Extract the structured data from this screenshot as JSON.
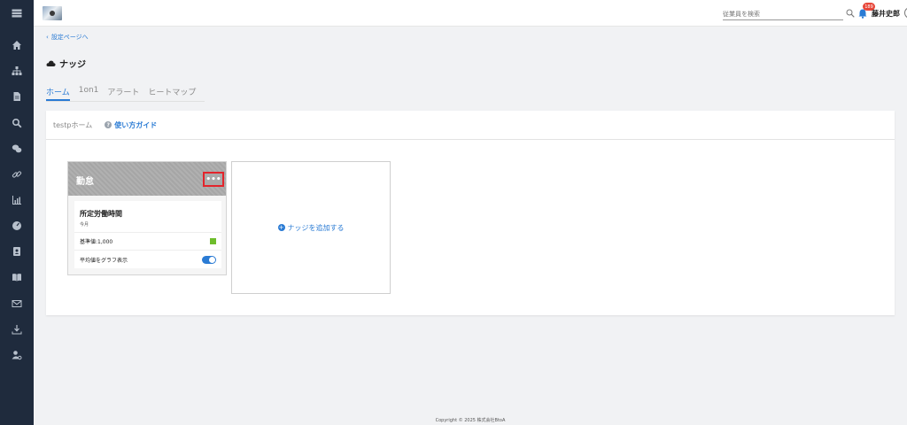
{
  "header": {
    "search_placeholder": "従業員を検索",
    "notification_count": "189",
    "user_name": "藤井史郎"
  },
  "sidebar": {
    "icons": [
      "menu-icon",
      "home-icon",
      "org-chart-icon",
      "document-icon",
      "search-icon",
      "chat-icon",
      "link-icon",
      "chart-icon",
      "gauge-icon",
      "contact-book-icon",
      "book-icon",
      "mail-icon",
      "download-icon",
      "user-settings-icon"
    ]
  },
  "page": {
    "back_link": "設定ページへ",
    "title": "ナッジ",
    "tabs": [
      {
        "label": "ホーム",
        "active": true
      },
      {
        "label": "1on1",
        "active": false
      },
      {
        "label": "アラート",
        "active": false
      },
      {
        "label": "ヒートマップ",
        "active": false
      }
    ]
  },
  "panel": {
    "subtitle": "testpホーム",
    "guide_link": "使い方ガイド",
    "card": {
      "title": "勤怠",
      "more_label": "•••",
      "metric_title": "所定労働時間",
      "metric_period": "今月",
      "baseline_label": "基準値:1,000",
      "baseline_color": "#6ebd2c",
      "graph_toggle_label": "平均値をグラフ表示",
      "graph_toggle_on": true
    },
    "add_label": "ナッジを追加する"
  },
  "footer": {
    "copyright": "Copyright © 2025 株式会社BtoA"
  },
  "colors": {
    "accent": "#2a7bd4",
    "sidebar_bg": "#1f2b3d",
    "highlight_border": "#e3242b",
    "badge": "#e8473a"
  }
}
